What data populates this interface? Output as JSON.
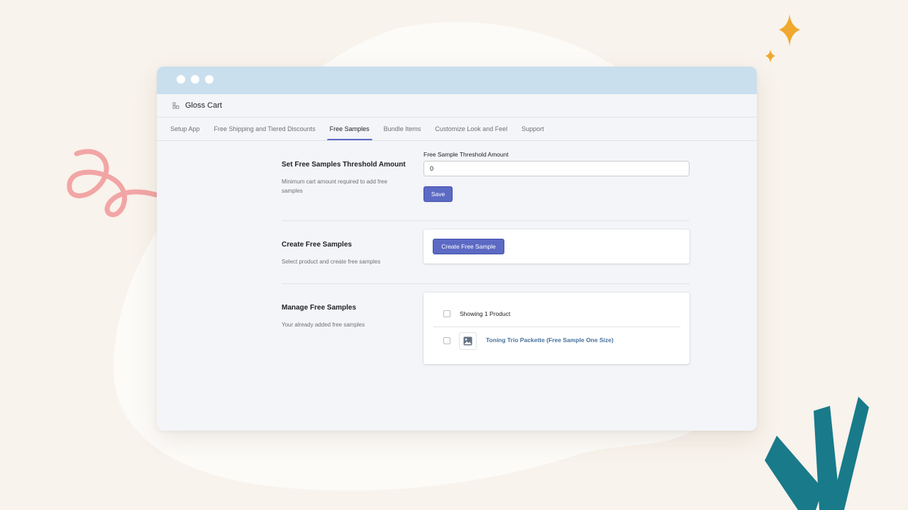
{
  "app": {
    "name": "Gloss Cart",
    "icon": "store-icon"
  },
  "tabs": [
    {
      "label": "Setup App",
      "active": false
    },
    {
      "label": "Free Shipping and Tiered Discounts",
      "active": false
    },
    {
      "label": "Free Samples",
      "active": true
    },
    {
      "label": "Bundle Items",
      "active": false
    },
    {
      "label": "Customize Look and Feel",
      "active": false
    },
    {
      "label": "Support",
      "active": false
    }
  ],
  "threshold": {
    "title": "Set Free Samples Threshold Amount",
    "description": "Minimum cart amount required to add free samples",
    "field_label": "Free Sample Threshold Amount",
    "value": "0",
    "save_label": "Save"
  },
  "create": {
    "title": "Create Free Samples",
    "description": "Select product and create free samples",
    "button_label": "Create Free Sample"
  },
  "manage": {
    "title": "Manage Free Samples",
    "description": "Your already added free samples",
    "list_header": "Showing 1 Product",
    "items": [
      {
        "name": "Toning Trio Packette (Free Sample One Size)",
        "thumb_icon": "image-placeholder-icon"
      }
    ]
  },
  "colors": {
    "accent": "#5c6ac4",
    "link": "#47719c",
    "titlebar": "#c9dfee",
    "background": "#f8f3ec"
  }
}
